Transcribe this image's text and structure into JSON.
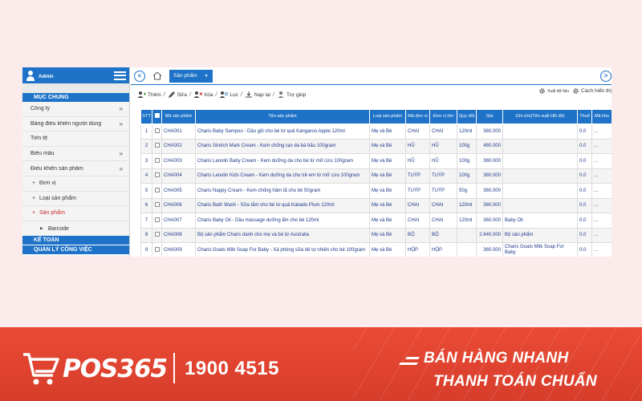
{
  "sidebar": {
    "user": "Admin",
    "section_general": "MỤC CHUNG",
    "items": [
      {
        "label": "Công ty",
        "chevron": "»"
      },
      {
        "label": "Bảng điều khiển người dùng",
        "chevron": "»"
      },
      {
        "label": "Tiền tệ",
        "chevron": ""
      },
      {
        "label": "Biểu mẫu",
        "chevron": "»"
      },
      {
        "label": "Điều khiển sản phẩm",
        "chevron": "»"
      }
    ],
    "subitems": [
      {
        "label": "Đơn vị"
      },
      {
        "label": "Loại sản phẩm"
      },
      {
        "label": "Sản phẩm"
      }
    ],
    "subsub": {
      "label": "Barcode"
    },
    "section_accounting": "KẾ TOÁN",
    "section_partial": "QUẢN LÝ CÔNG VIỆC"
  },
  "tabs": {
    "active": "Sản phẩm",
    "caret": "▼"
  },
  "toolbar": {
    "add": "Thêm",
    "edit": "Sửa",
    "delete": "Xóa",
    "filter": "Lọc",
    "reload": "Nạp lại",
    "help": "Trợ giúp",
    "sep": "/",
    "export": "Xuất dữ liệu",
    "display": "Cách hiển thị"
  },
  "table": {
    "headers": [
      "STT",
      "",
      "Mã sản phẩm",
      "Tên sản phẩm",
      "Loại sản phẩm",
      "Mã đơn vị",
      "Đơn vị lớn",
      "Quy đổi",
      "Giá",
      "Ghi chú(Tên xuất HĐ đỏ)",
      "Thuế",
      "Mã kho"
    ],
    "rows": [
      [
        "1",
        "",
        "CHA001",
        "Charis Baby Sampoo - Dầu gội cho bé từ quả Kangaroo Apple 120ml",
        "Mẹ và Bé",
        "CHAI",
        "CHAI",
        "120ml",
        "360.000",
        "",
        "0.0",
        "..."
      ],
      [
        "2",
        "",
        "CHA002",
        "Charis Stretch Mark Cream - Kem chống rạn da bà bầu 100gram",
        "Mẹ và Bé",
        "HŨ",
        "HŨ",
        "100g",
        "480.000",
        "",
        "0.0",
        "..."
      ],
      [
        "3",
        "",
        "CHA003",
        "Charis Lanolin Baby Cream - Kem dưỡng da cho bé từ mỡ cừu 100gram",
        "Mẹ và Bé",
        "HŨ",
        "HŨ",
        "100g",
        "360.000",
        "",
        "0.0",
        "..."
      ],
      [
        "4",
        "",
        "CHA004",
        "Charis Lanolin Kids Cream - Kem dưỡng da cho trẻ em từ mỡ cừu 100gram",
        "Mẹ và Bé",
        "TUÝP",
        "TUÝP",
        "100g",
        "360.000",
        "",
        "0.0",
        "..."
      ],
      [
        "5",
        "",
        "CHA005",
        "Charis Nappy Cream - Kem chống hăm tã cho bé 50gram",
        "Mẹ và Bé",
        "TUÝP",
        "TUÝP",
        "50g",
        "360.000",
        "",
        "0.0",
        "..."
      ],
      [
        "6",
        "",
        "CHA006",
        "Charis Bath Wash - Sữa tắm cho bé từ quả Kakadu Plum 120ml",
        "Mẹ và Bé",
        "CHAI",
        "CHAI",
        "120ml",
        "360.000",
        "",
        "0.0",
        "..."
      ],
      [
        "7",
        "",
        "CHA007",
        "Charis Baby Oil - Dầu massage dưỡng ẩm cho bé 120ml",
        "Mẹ và Bé",
        "CHAI",
        "CHAI",
        "120ml",
        "360.000",
        "Baby Oil",
        "0.0",
        "..."
      ],
      [
        "8",
        "",
        "CHA008",
        "Bộ sản phẩm Charis dành cho mẹ và bé từ Australia",
        "Mẹ và Bé",
        "BỘ",
        "BỘ",
        "",
        "2.640.000",
        "Bộ sản phẩm",
        "0.0",
        "..."
      ],
      [
        "9",
        "",
        "CHA009",
        "Charis Goats Milk Soap For Baby - Xà phòng sữa dê tự nhiên cho bé 100gram",
        "Mẹ và Bé",
        "HỘP",
        "HỘP",
        "",
        "360.000",
        "Charis Goats Milk Soap For Baby",
        "0.0",
        "..."
      ]
    ]
  },
  "banner": {
    "logo": "POS365",
    "hotline": "1900 4515",
    "slogan_line1": "BÁN HÀNG NHANH",
    "slogan_line2": "THANH TOÁN CHUẨN"
  },
  "icons": {
    "back": "back-arrow-icon",
    "home": "home-icon",
    "forward": "forward-arrow-icon",
    "menu": "hamburger-menu-icon",
    "cart": "cart-icon"
  },
  "colors": {
    "primary": "#1e73c8",
    "banner": "#e04430",
    "active_menu": "#c92a2a",
    "page_bg": "#fbeceb"
  }
}
